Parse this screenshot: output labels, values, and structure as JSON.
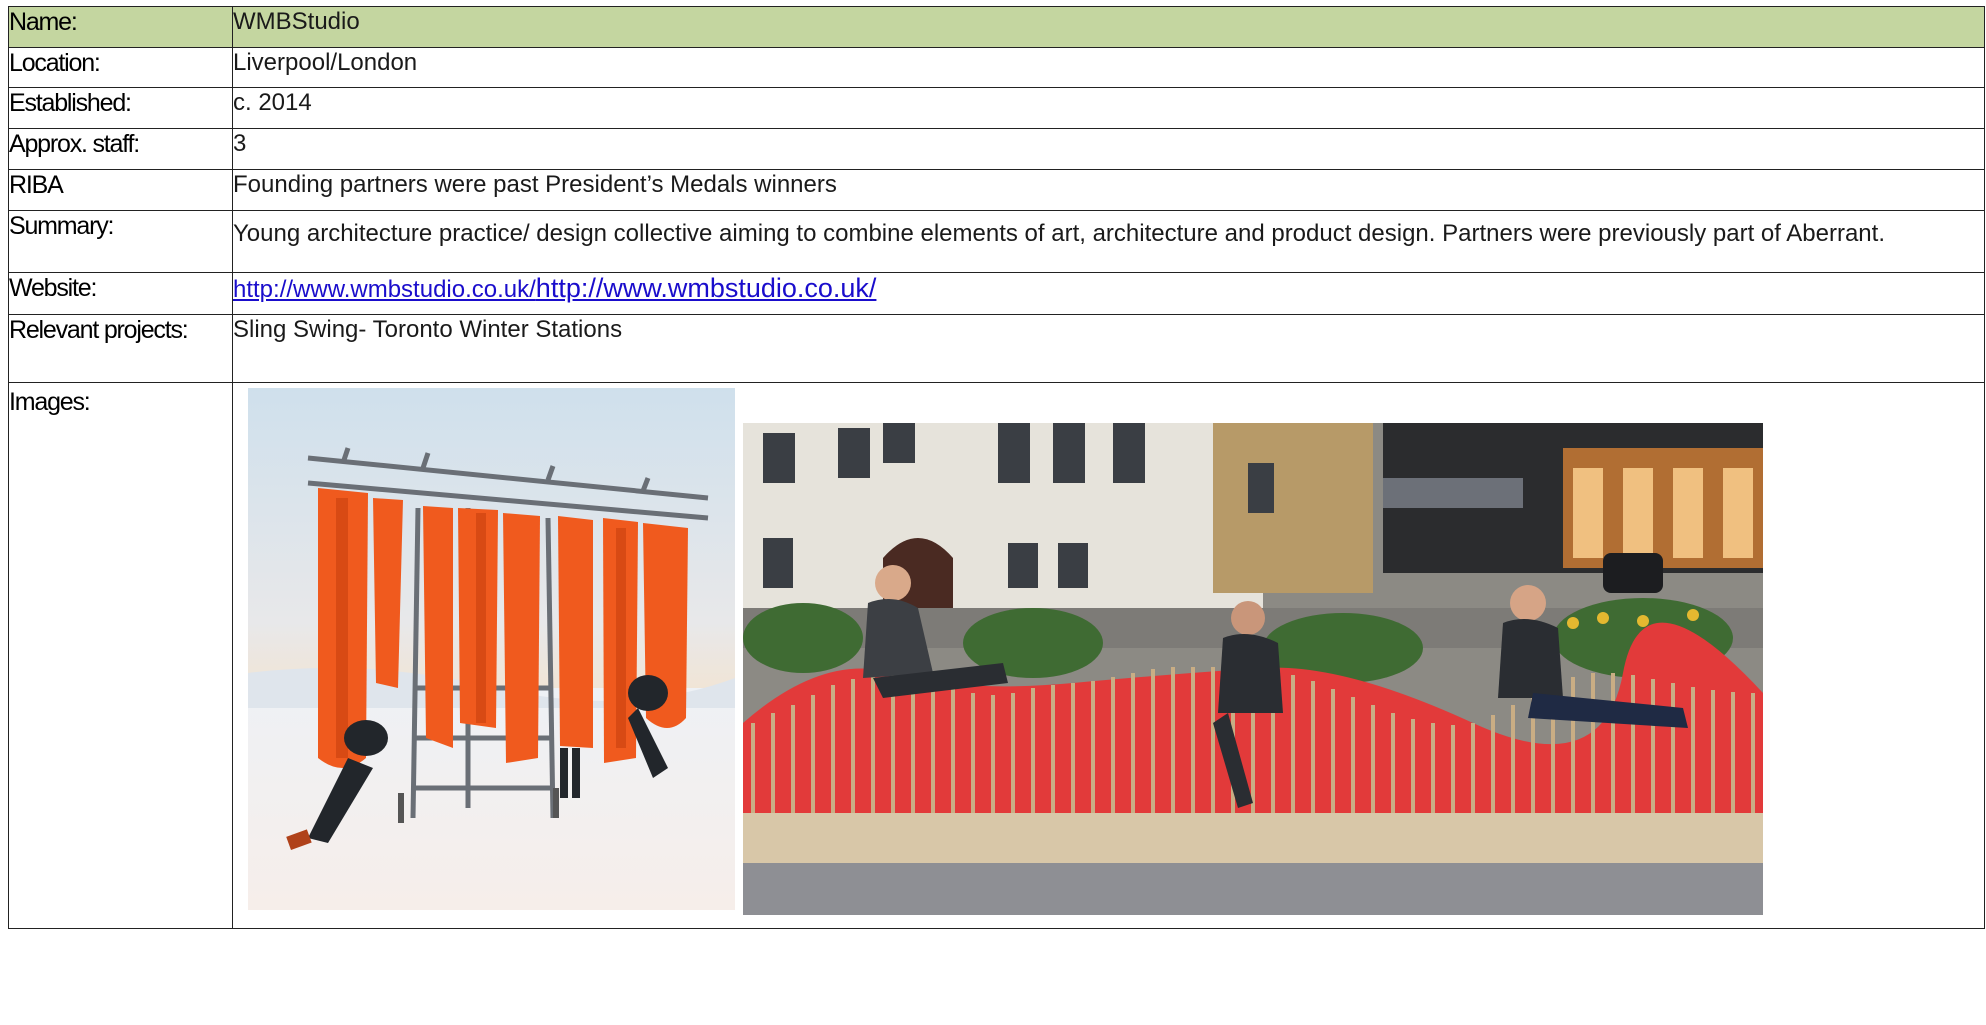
{
  "rows": {
    "name": {
      "label": "Name:",
      "value": "WMBStudio"
    },
    "location": {
      "label": "Location:",
      "value": "Liverpool/London"
    },
    "established": {
      "label": "Established:",
      "value": "c. 2014"
    },
    "staff": {
      "label": "Approx. staff:",
      "value": "3"
    },
    "riba": {
      "label": "RIBA",
      "value": "Founding partners were past President’s Medals winners"
    },
    "summary": {
      "label": "Summary:",
      "value": "Young architecture practice/ design collective aiming to combine elements of art, architecture and product design. Partners were previously part of Aberrant."
    },
    "website": {
      "label": "Website:",
      "link_small": "http://www.wmbstudio.co.uk/",
      "link_large": "http://www.wmbstudio.co.uk/"
    },
    "projects": {
      "label": "Relevant projects:",
      "value": "Sling Swing- Toronto Winter Stations"
    },
    "images": {
      "label": "Images:"
    }
  },
  "colors": {
    "header_bg": "#c4d6a0",
    "link": "#1a0dcc",
    "border": "#222222"
  }
}
